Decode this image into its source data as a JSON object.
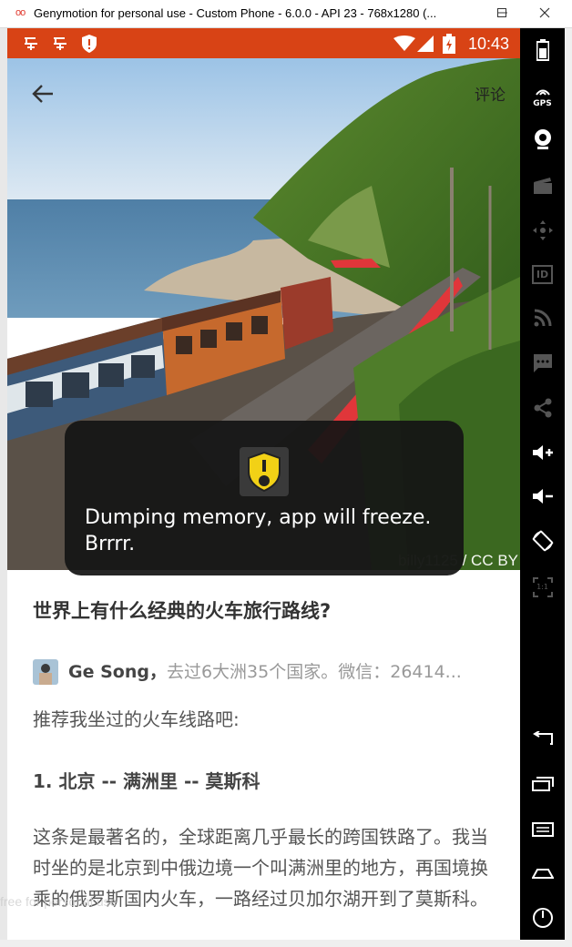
{
  "window": {
    "logo": "oo",
    "title": "Genymotion for personal use - Custom Phone - 6.0.0 - API 23 - 768x1280 (...",
    "minimize_icon": "minimize-icon",
    "maximize_icon": "maximize-icon",
    "close_icon": "close-icon"
  },
  "statusbar": {
    "time": "10:43",
    "left_icons": [
      "zhihu-icon",
      "zhihu-icon",
      "shield-icon"
    ],
    "right_icons": [
      "wifi-icon",
      "signal-icon",
      "battery-icon"
    ],
    "color": "#d84315"
  },
  "hero": {
    "comment_label": "评论",
    "credit_author": "billy1125",
    "credit_license": " / CC BY"
  },
  "toast": {
    "message": "Dumping memory, app will freeze. Brrrr."
  },
  "article": {
    "question_title": "世界上有什么经典的火车旅行路线?",
    "author_name": "Ge Song，",
    "author_bio": "去过6大洲35个国家。微信：26414...",
    "intro": "推荐我坐过的火车线路吧:",
    "heading_1": "1. 北京 -- 满洲里 -- 莫斯科",
    "body_1": "这条是最著名的，全球距离几乎最长的跨国铁路了。我当时坐的是北京到中俄边境一个叫满洲里的地方，再国境换乘的俄罗斯国内火车，一路经过贝加尔湖开到了莫斯科。"
  },
  "watermark": "free for personal use",
  "sidebar": {
    "buttons": [
      "battery-icon",
      "gps-icon",
      "webcam-icon",
      "clapper-icon",
      "move-icon",
      "id-icon",
      "rss-icon",
      "sms-icon",
      "share-icon",
      "volume-up-icon",
      "volume-down-icon",
      "rotate-icon",
      "scale-icon",
      "back-icon",
      "recent-apps-icon",
      "menu-icon",
      "home-icon",
      "power-icon"
    ],
    "gps_label": "GPS",
    "id_label": "ID",
    "scale_label": "1:1"
  }
}
